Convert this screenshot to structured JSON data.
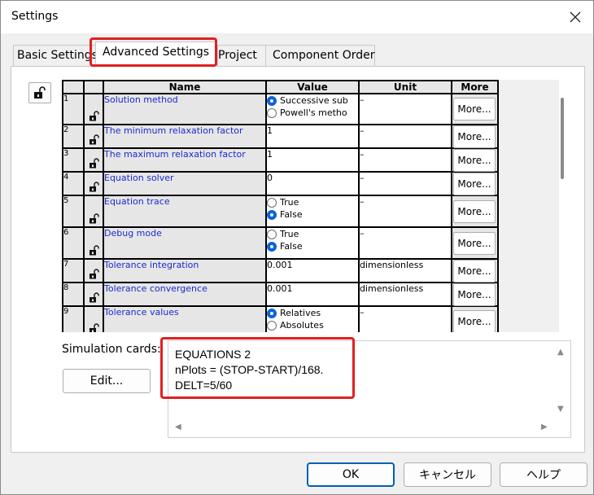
{
  "window": {
    "title": "Settings",
    "close_icon": "close-icon"
  },
  "tabs": [
    {
      "label": "Basic Settings"
    },
    {
      "label": "Advanced Settings"
    },
    {
      "label": "Project"
    },
    {
      "label": "Component Order"
    }
  ],
  "grid": {
    "headers": {
      "name": "Name",
      "value": "Value",
      "unit": "Unit",
      "more": "More"
    },
    "more_label": "More...",
    "rows": [
      {
        "num": "1",
        "name": "Solution method",
        "type": "radio",
        "options": [
          "Successive sub",
          "Powell's metho"
        ],
        "selected": 0,
        "unit": "–"
      },
      {
        "num": "2",
        "name": "The minimum relaxation factor",
        "type": "text",
        "value": "1",
        "unit": "–"
      },
      {
        "num": "3",
        "name": "The maximum relaxation factor",
        "type": "text",
        "value": "1",
        "unit": "–"
      },
      {
        "num": "4",
        "name": "Equation solver",
        "type": "text",
        "value": "0",
        "unit": "–"
      },
      {
        "num": "5",
        "name": "Equation trace",
        "type": "radio",
        "options": [
          "True",
          "False"
        ],
        "selected": 1,
        "unit": "–"
      },
      {
        "num": "6",
        "name": "Debug mode",
        "type": "radio",
        "options": [
          "True",
          "False"
        ],
        "selected": 1,
        "unit": "–"
      },
      {
        "num": "7",
        "name": "Tolerance integration",
        "type": "text",
        "value": "0.001",
        "unit": "dimensionless"
      },
      {
        "num": "8",
        "name": "Tolerance convergence",
        "type": "text",
        "value": "0.001",
        "unit": "dimensionless"
      },
      {
        "num": "9",
        "name": "Tolerance values",
        "type": "radio",
        "options": [
          "Relatives",
          "Absolutes"
        ],
        "selected": 0,
        "unit": "–"
      }
    ]
  },
  "simulation": {
    "label": "Simulation cards:",
    "edit_label": "Edit...",
    "lines": [
      "EQUATIONS 2",
      "nPlots = (STOP-START)/168.",
      "DELT=5/60"
    ]
  },
  "buttons": {
    "ok": "OK",
    "cancel": "キャンセル",
    "help": "ヘルプ"
  },
  "colors": {
    "highlight": "#e02020",
    "name_text": "#1a2bd0",
    "radio_selected": "#0a64d8"
  }
}
